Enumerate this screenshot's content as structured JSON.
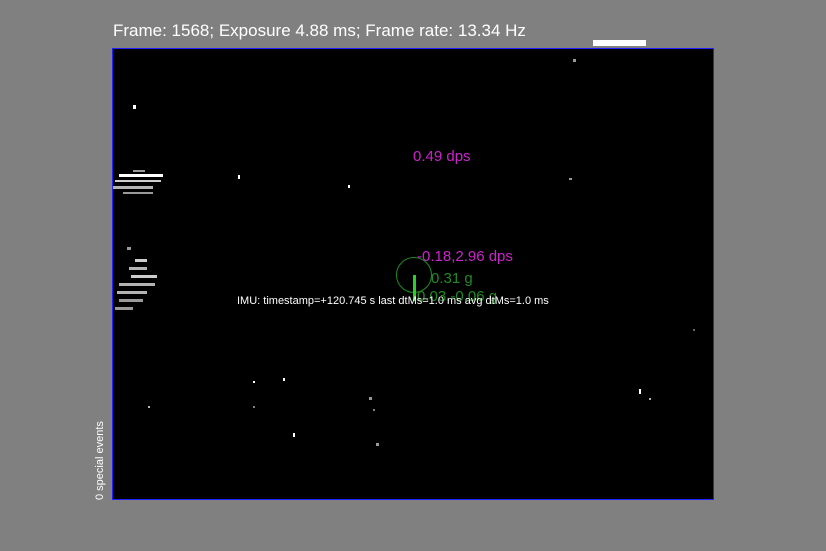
{
  "status": {
    "text": "Frame: 1568; Exposure 4.88 ms; Frame rate: 13.34 Hz"
  },
  "imu": {
    "text": "IMU: timestamp=+120.745 s last dtMs=1.0   ms  avg dtMs=1.0   ms"
  },
  "gyro": {
    "upper_label": "0.49 dps",
    "lower_label": "-0.18,2.96 dps"
  },
  "accel": {
    "magnitude_label": "0.31 g",
    "components_label": "0.03,-0.06 g"
  },
  "sidebar": {
    "special_events_label": "0 special events"
  },
  "colors": {
    "background": "#808080",
    "viewer": "#000000",
    "gyro": "#cc22cc",
    "accel": "#1e8c1e",
    "border": "#2020ff"
  }
}
